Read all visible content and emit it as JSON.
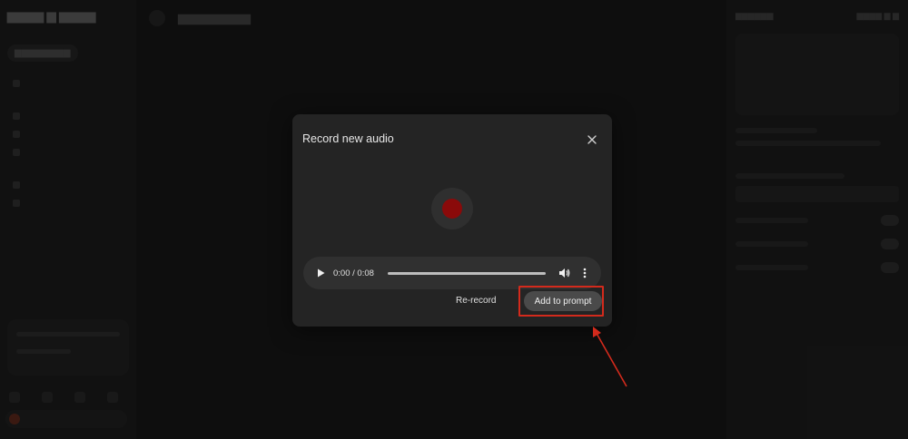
{
  "modal": {
    "title": "Record new audio",
    "player": {
      "time": "0:00 / 0:08"
    },
    "rerecord_label": "Re-record",
    "add_label": "Add to prompt"
  },
  "colors": {
    "record_dot": "#8a0a0a",
    "annotation": "#d32a1c"
  },
  "icons": {
    "close": "close-icon",
    "play": "play-icon",
    "volume": "volume-icon",
    "more": "more-vert-icon",
    "record": "record-icon"
  }
}
